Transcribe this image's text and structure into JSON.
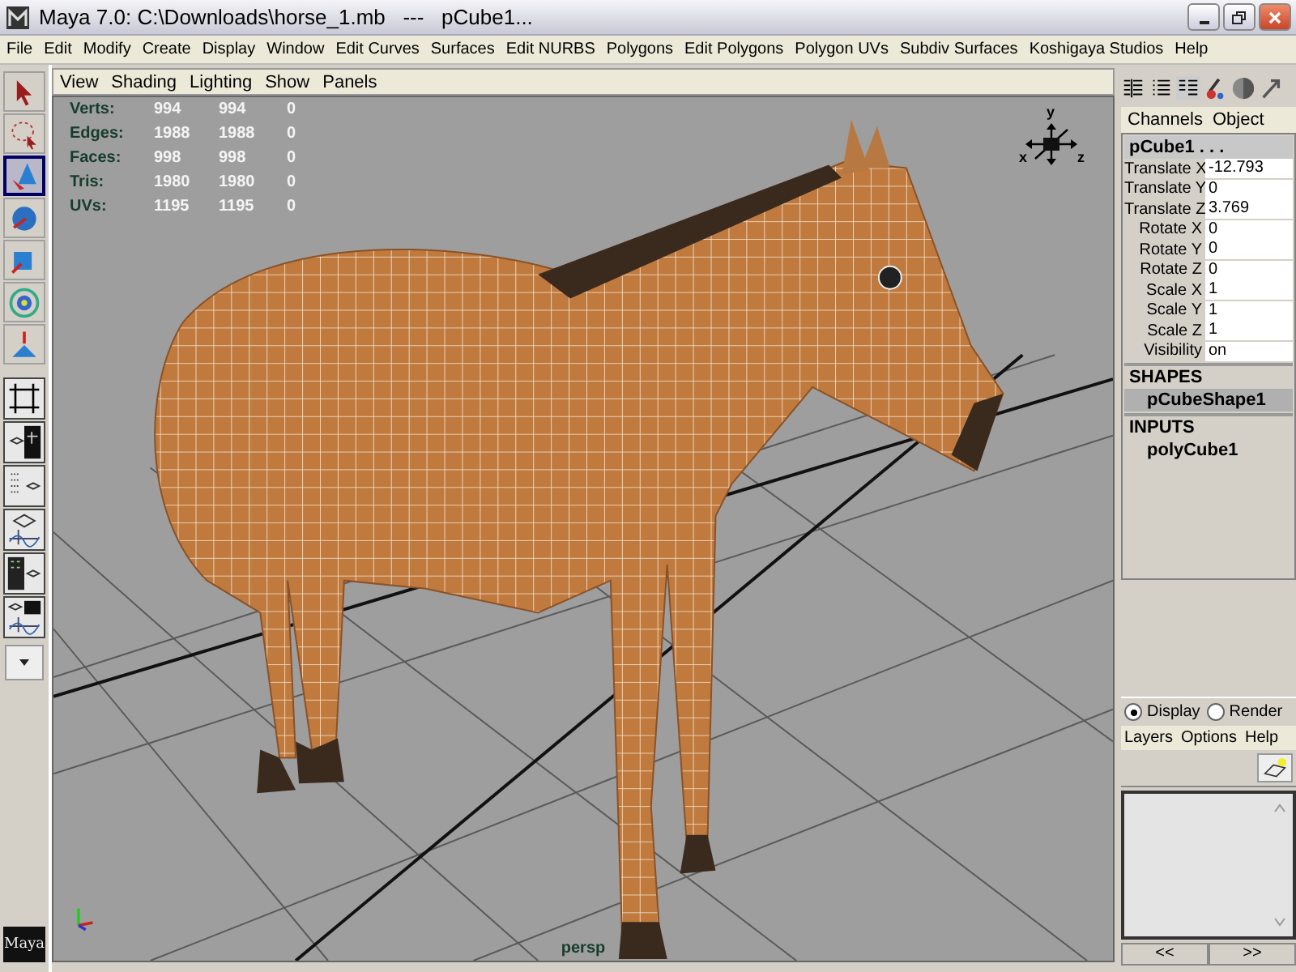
{
  "window": {
    "title": "Maya 7.0: C:\\Downloads\\horse_1.mb   ---   pCube1..."
  },
  "menu_bar": [
    "File",
    "Edit",
    "Modify",
    "Create",
    "Display",
    "Window",
    "Edit Curves",
    "Surfaces",
    "Edit NURBS",
    "Polygons",
    "Edit Polygons",
    "Polygon UVs",
    "Subdiv Surfaces",
    "Koshigaya Studios",
    "Help"
  ],
  "tools": [
    {
      "kind": "select",
      "selected": false
    },
    {
      "kind": "lasso",
      "selected": false
    },
    {
      "kind": "move",
      "selected": true
    },
    {
      "kind": "rotate",
      "selected": false
    },
    {
      "kind": "scale",
      "selected": false
    },
    {
      "kind": "manipulator",
      "selected": false
    },
    {
      "kind": "last",
      "selected": false
    }
  ],
  "panel_menu": [
    "View",
    "Shading",
    "Lighting",
    "Show",
    "Panels"
  ],
  "hud_stats": [
    {
      "label": "Verts:",
      "values": [
        "994",
        "994",
        "0"
      ]
    },
    {
      "label": "Edges:",
      "values": [
        "1988",
        "1988",
        "0"
      ]
    },
    {
      "label": "Faces:",
      "values": [
        "998",
        "998",
        "0"
      ]
    },
    {
      "label": "Tris:",
      "values": [
        "1980",
        "1980",
        "0"
      ]
    },
    {
      "label": "UVs:",
      "values": [
        "1195",
        "1195",
        "0"
      ]
    }
  ],
  "viewport": {
    "camera_label": "persp",
    "view_axes": [
      "y",
      "x",
      "z"
    ]
  },
  "channel_box": {
    "menu": [
      "Channels",
      "Object"
    ],
    "node": "pCube1 . . .",
    "attributes": [
      {
        "name": "Translate X",
        "value": "-12.793"
      },
      {
        "name": "Translate Y",
        "value": "0"
      },
      {
        "name": "Translate Z",
        "value": "3.769"
      },
      {
        "name": "Rotate X",
        "value": "0"
      },
      {
        "name": "Rotate Y",
        "value": "0"
      },
      {
        "name": "Rotate Z",
        "value": "0"
      },
      {
        "name": "Scale X",
        "value": "1"
      },
      {
        "name": "Scale Y",
        "value": "1"
      },
      {
        "name": "Scale Z",
        "value": "1"
      },
      {
        "name": "Visibility",
        "value": "on"
      }
    ],
    "sections": [
      {
        "heading": "SHAPES",
        "items": [
          {
            "label": "pCubeShape1",
            "selected": true
          }
        ]
      },
      {
        "heading": "INPUTS",
        "items": [
          {
            "label": "polyCube1",
            "selected": false
          }
        ]
      }
    ]
  },
  "layer_editor": {
    "modes": [
      {
        "label": "Display",
        "selected": true
      },
      {
        "label": "Render",
        "selected": false
      }
    ],
    "menu": [
      "Layers",
      "Options",
      "Help"
    ],
    "page_buttons": [
      "<<",
      ">>"
    ]
  },
  "logo": "Maya"
}
